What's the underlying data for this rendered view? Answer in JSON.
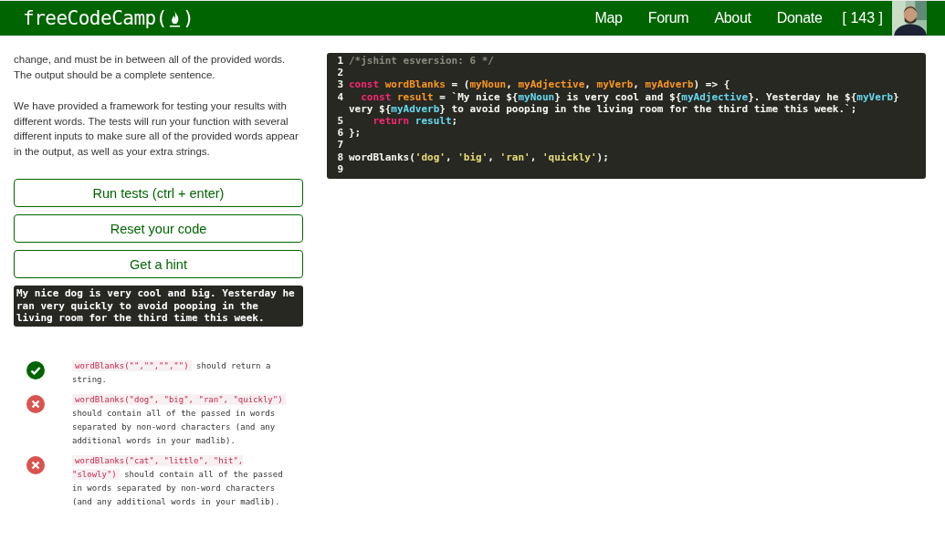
{
  "header": {
    "logo_start": "freeCodeCamp(",
    "logo_end": ")",
    "nav": [
      "Map",
      "Forum",
      "About",
      "Donate"
    ],
    "points": "[ 143 ]"
  },
  "description": [
    "change, and must be in between all of the provided words. The output should be a complete sentence.",
    "We have provided a framework for testing your results with different words. The tests will run your function with several different inputs to make sure all of the provided words appear in the output, as well as your extra strings."
  ],
  "buttons": [
    "Run tests (ctrl + enter)",
    "Reset your code",
    "Get a hint"
  ],
  "output": "My nice dog is very cool and big. Yesterday he ran very quickly to avoid pooping in the living room for the third time this week.",
  "tests": [
    {
      "passed": true,
      "code": "wordBlanks(\"\",\"\",\"\",\"\")",
      "text": "should return a string."
    },
    {
      "passed": false,
      "code": "wordBlanks(\"dog\", \"big\", \"ran\", \"quickly\")",
      "text": "should contain all of the passed in words separated by non-word characters (and any additional words in your madlib)."
    },
    {
      "passed": false,
      "code": "wordBlanks(\"cat\", \"little\", \"hit\", \"slowly\")",
      "text": "should contain all of the passed in words separated by non-word characters (and any additional words in your madlib)."
    }
  ],
  "editor": {
    "lines": [
      {
        "number": "1",
        "tokens": [
          {
            "kind": "comment",
            "text": "/*jshint esversion: 6 */"
          }
        ]
      },
      {
        "number": "2"
      },
      {
        "number": "3",
        "tokens": [
          {
            "kind": "keyword",
            "text": "const"
          },
          {
            "kind": "def",
            "text": " wordBlanks"
          },
          {
            "kind": "plain",
            "text": " = ("
          },
          {
            "kind": "def",
            "text": "myNoun"
          },
          {
            "kind": "plain",
            "text": ", "
          },
          {
            "kind": "def",
            "text": "myAdjective"
          },
          {
            "kind": "plain",
            "text": ", "
          },
          {
            "kind": "def",
            "text": "myVerb"
          },
          {
            "kind": "plain",
            "text": ", "
          },
          {
            "kind": "def",
            "text": "myAdverb"
          },
          {
            "kind": "plain",
            "text": ") => {"
          }
        ]
      },
      {
        "number": "4",
        "tokens": [
          {
            "kind": "keyword",
            "text": "  const"
          },
          {
            "kind": "def",
            "text": " result"
          },
          {
            "kind": "plain",
            "text": " = `My nice ${"
          },
          {
            "kind": "var",
            "text": "myNoun"
          },
          {
            "kind": "plain",
            "text": "} is very cool and ${"
          },
          {
            "kind": "var",
            "text": "myAdjective"
          },
          {
            "kind": "plain",
            "text": "}. Yesterday he ${"
          },
          {
            "kind": "var",
            "text": "myVerb"
          },
          {
            "kind": "plain",
            "text": "}"
          }
        ],
        "wrap": [
          {
            "kind": "plain",
            "text": "very ${"
          },
          {
            "kind": "var",
            "text": "myAdverb"
          },
          {
            "kind": "plain",
            "text": "} to avoid pooping in the living room for the third time this week.`;"
          }
        ]
      },
      {
        "number": "5",
        "tokens": [
          {
            "kind": "keyword",
            "text": "    return"
          },
          {
            "kind": "var",
            "text": " result"
          },
          {
            "kind": "plain",
            "text": ";"
          }
        ]
      },
      {
        "number": "6",
        "tokens": [
          {
            "kind": "plain",
            "text": "};"
          }
        ]
      },
      {
        "number": "7"
      },
      {
        "number": "8",
        "tokens": [
          {
            "kind": "plain",
            "text": "wordBlanks("
          },
          {
            "kind": "string",
            "text": "'dog'"
          },
          {
            "kind": "plain",
            "text": ", "
          },
          {
            "kind": "string",
            "text": "'big'"
          },
          {
            "kind": "plain",
            "text": ", "
          },
          {
            "kind": "string",
            "text": "'ran'"
          },
          {
            "kind": "plain",
            "text": ", "
          },
          {
            "kind": "string",
            "text": "'quickly'"
          },
          {
            "kind": "plain",
            "text": ");"
          }
        ]
      },
      {
        "number": "9"
      }
    ]
  }
}
